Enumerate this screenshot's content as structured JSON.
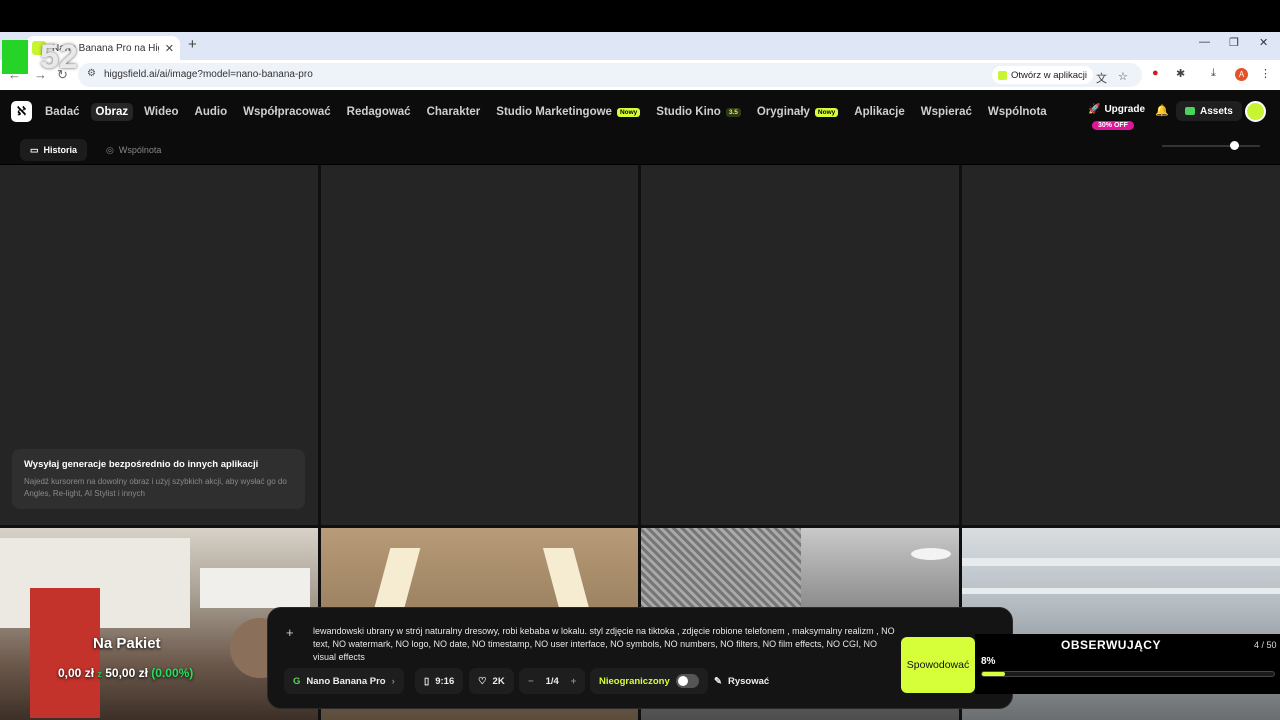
{
  "browser": {
    "tab_title": "Nano Banana Pro na Higgsfield",
    "url": "higgsfield.ai/ai/image?model=nano-banana-pro",
    "open_app": "Otwórz w aplikacji",
    "profile_initial": "A"
  },
  "overlay_counter": "52",
  "nav": {
    "items": [
      {
        "label": "Badać"
      },
      {
        "label": "Obraz"
      },
      {
        "label": "Wideo"
      },
      {
        "label": "Audio"
      },
      {
        "label": "Współpracować"
      },
      {
        "label": "Redagować"
      },
      {
        "label": "Charakter"
      },
      {
        "label": "Studio Marketingowe",
        "badge": "Nowy"
      },
      {
        "label": "Studio Kino",
        "badge": "3.5"
      },
      {
        "label": "Oryginały",
        "badge": "Nowy"
      },
      {
        "label": "Aplikacje"
      },
      {
        "label": "Wspierać"
      },
      {
        "label": "Wspólnota"
      }
    ],
    "upgrade": "Upgrade",
    "discount": "30% OFF",
    "assets": "Assets"
  },
  "subnav": {
    "history": "Historia",
    "community": "Wspólnota"
  },
  "hint": {
    "title": "Wysyłaj generacje bezpośrednio do innych aplikacji",
    "desc": "Najedź kursorem na dowolny obraz i użyj szybkich akcji, aby wysłać go do Angles, Re-light, AI Stylist i innych"
  },
  "stream_overlay": {
    "title": "Na Pakiet",
    "current": "0,00 zł",
    "separator": "z",
    "goal": "50,00 zł",
    "percent": "(0.00%)"
  },
  "prompt": {
    "text": "lewandowski ubrany w strój naturalny dresowy, robi kebaba w lokalu. styl zdjęcie na tiktoka , zdjęcie robione telefonem , maksymalny realizm , NO text, NO watermark, NO logo, NO date, NO timestamp, NO user interface, NO symbols, NO numbers, NO filters, NO film effects, NO CGI, NO visual effects",
    "model": "Nano Banana Pro",
    "aspect": "9:16",
    "quality": "2K",
    "count": "1/4",
    "unlimited": "Nieograniczony",
    "draw": "Rysować",
    "generate": "Spowodować"
  },
  "watchers": {
    "title": "OBSERWUJĄCY",
    "count": "4 / 50",
    "percent_label": "8%",
    "progress": 0.08
  }
}
